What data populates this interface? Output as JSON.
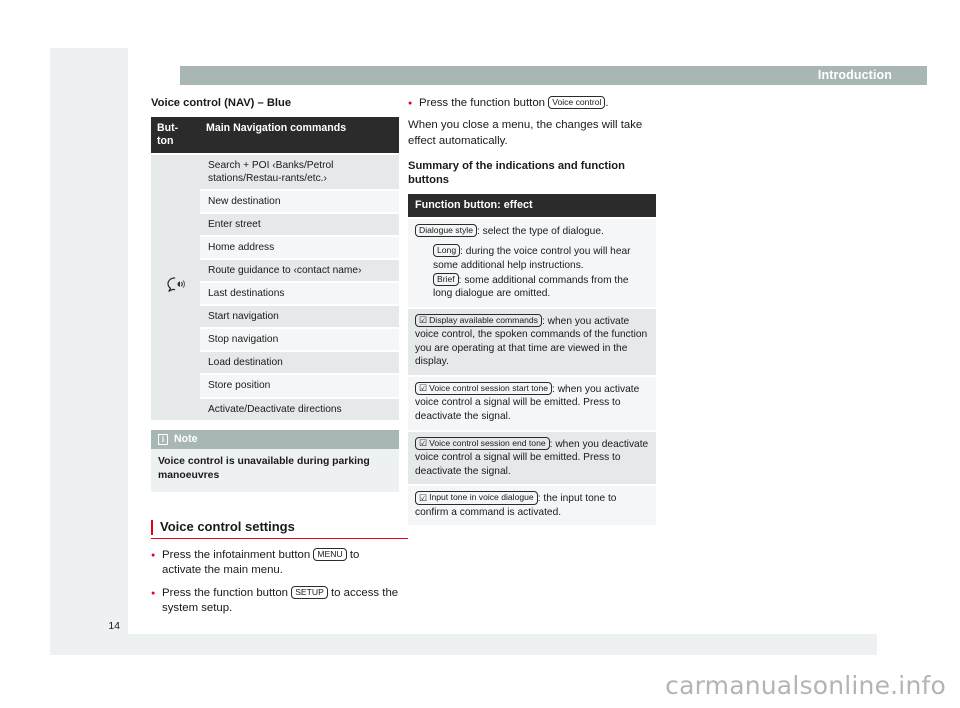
{
  "header": {
    "title": "Introduction"
  },
  "folio": {
    "page_number": "14"
  },
  "watermark": {
    "text": "carmanualsonline.info"
  },
  "colors": {
    "header_band": "#a9b6b6",
    "table_header": "#2b2b2b",
    "accent_red": "#e3001b",
    "row_dark": "#e5e9ea",
    "row_light": "#f4f6f7",
    "page_margin": "#eef1f2"
  },
  "left_column": {
    "section_title": "Voice control (NAV) – Blue",
    "table": {
      "headers": [
        "But-\nton",
        "Main Navigation commands"
      ],
      "icon_name": "voice-control-icon",
      "rows": [
        "Search + POI ‹Banks/Petrol stations/Restau-rants/etc.›",
        "New destination",
        "Enter street",
        "Home address",
        "Route guidance to ‹contact name›",
        "Last destinations",
        "Start navigation",
        "Stop navigation",
        "Load destination",
        "Store position",
        "Activate/Deactivate directions"
      ]
    },
    "note": {
      "icon": "info-icon",
      "label": "Note",
      "text": "Voice control is unavailable during parking manoeuvres"
    },
    "settings": {
      "heading": "Voice control settings",
      "bullets": [
        {
          "pre": "Press the infotainment button ",
          "key": "MENU",
          "post": " to activate the main menu."
        },
        {
          "pre": "Press the function button ",
          "key": "SETUP",
          "post": " to access the system setup."
        }
      ]
    }
  },
  "right_column": {
    "bullet": {
      "pre": "Press the function button ",
      "key": "Voice control",
      "post": "."
    },
    "paragraph": "When you close a menu, the changes will take effect automatically.",
    "section_title": "Summary of the indications and function buttons",
    "table": {
      "header": "Function button: effect",
      "rows": [
        {
          "key": "Dialogue style",
          "checkbox": false,
          "text": ": select the type of dialogue.",
          "sub": [
            {
              "key": "Long",
              "text": ": during the voice control you will hear some additional help instructions."
            },
            {
              "key": "Brief",
              "text": ": some additional commands from the long dialogue are omitted."
            }
          ]
        },
        {
          "key": "Display available commands",
          "checkbox": true,
          "text": ": when you activate voice control, the spoken commands of the function you are operating at that time are viewed in the display.",
          "sub": []
        },
        {
          "key": "Voice control session start tone",
          "checkbox": true,
          "text": ": when you activate voice control a signal will be emitted. Press to deactivate the signal.",
          "sub": []
        },
        {
          "key": "Voice control session end tone",
          "checkbox": true,
          "text": ": when you deactivate voice control a signal will be emitted. Press to deactivate the signal.",
          "sub": []
        },
        {
          "key": "Input tone in voice dialogue",
          "checkbox": true,
          "text": ": the input tone to confirm a command is activated.",
          "sub": []
        }
      ]
    }
  }
}
